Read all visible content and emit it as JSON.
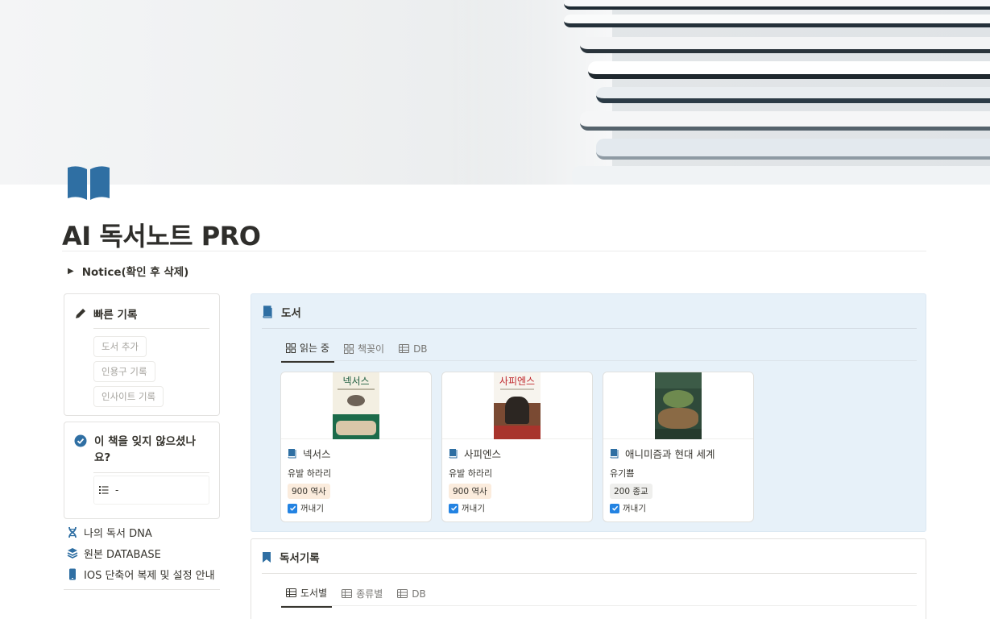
{
  "page": {
    "title": "AI 독서노트 PRO",
    "notice": "Notice(확인 후 삭제)"
  },
  "colors": {
    "accent": "#2f6fa3",
    "panel_bg": "#e7f1f9",
    "tag_orange": "#fbecdd",
    "tag_gray": "#efefed",
    "checkbox": "#2383e2"
  },
  "quick_record": {
    "title": "빠른 기록",
    "buttons": [
      "도서 추가",
      "인용구 기록",
      "인사이트 기록"
    ]
  },
  "reminder": {
    "title": "이 책을 잊지 않으셨나요?",
    "item": "-"
  },
  "links": [
    {
      "label": "나의 독서 DNA",
      "icon": "dna-icon"
    },
    {
      "label": "원본 DATABASE",
      "icon": "layers-icon"
    },
    {
      "label": "IOS 단축어 복제 및 설정 안내",
      "icon": "phone-icon"
    }
  ],
  "books_panel": {
    "title": "도서",
    "tabs": [
      "읽는 중",
      "책꽂이",
      "DB"
    ],
    "items": [
      {
        "title": "넥서스",
        "author": "유발 하라리",
        "tag": "900 역사",
        "checkbox_label": "꺼내기"
      },
      {
        "title": "사피엔스",
        "author": "유발 하라리",
        "tag": "900 역사",
        "checkbox_label": "꺼내기"
      },
      {
        "title": "애니미즘과 현대 세계",
        "author": "유기쁨",
        "tag": "200 종교",
        "checkbox_label": "꺼내기"
      }
    ]
  },
  "notes_panel": {
    "title": "독서기록",
    "tabs": [
      "도서별",
      "종류별",
      "DB"
    ]
  }
}
